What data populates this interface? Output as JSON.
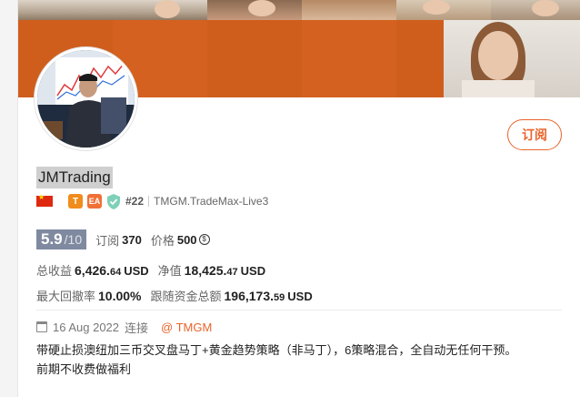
{
  "profile": {
    "name": "JMTrading",
    "subscribe_label": "订阅",
    "rank": "#22",
    "server": "TMGM.TradeMax-Live3",
    "badge_t": "T",
    "badge_ea": "EA",
    "flag": "china-flag"
  },
  "score": {
    "value": "5.9",
    "denominator": "/10",
    "subs_label": "订阅",
    "subs_value": "370",
    "price_label": "价格",
    "price_value": "500"
  },
  "stats": {
    "total_profit_label": "总收益",
    "total_profit_int": "6,426.",
    "total_profit_dec": "64",
    "total_profit_unit": "USD",
    "equity_label": "净值",
    "equity_int": "18,425.",
    "equity_dec": "47",
    "equity_unit": "USD",
    "drawdown_label": "最大回撤率",
    "drawdown_value": "10.00%",
    "follow_label": "跟随资金总额",
    "follow_int": "196,173.",
    "follow_dec": "59",
    "follow_unit": "USD"
  },
  "meta": {
    "date": "16 Aug 2022",
    "connect_label": "连接",
    "broker": "@ TMGM"
  },
  "description": {
    "line1": "带硬止损澳纽加三币交叉盘马丁+黄金趋势策略（非马丁），6策略混合，全自动无任何干预。",
    "line2": "前期不收费做福利"
  },
  "colors": {
    "accent": "#e8642a",
    "banner": "#cf5e1d",
    "score_bg": "#7f8aa0"
  }
}
